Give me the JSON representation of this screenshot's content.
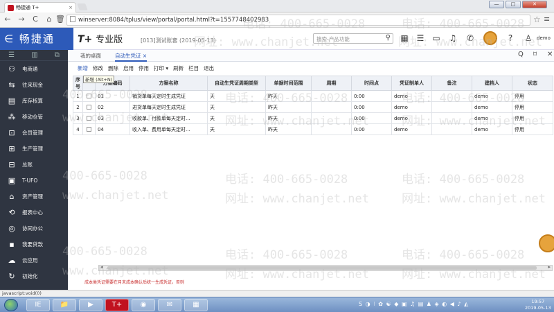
{
  "browser": {
    "tab_title": "畅捷通 T+",
    "tab_close": "×",
    "url": "winserver:8084/tplus/view/portal/portal.html?t=1557748402983",
    "back": "←",
    "forward": "→",
    "reload": "C",
    "home": "⌂",
    "star": "☆",
    "menu": "≡",
    "min": "—",
    "max": "□",
    "close": "✕"
  },
  "header": {
    "logo": "∈ 畅捷通",
    "product": "T+",
    "edition": "专业版",
    "account": "[013]测试账套 (2019-05-13)",
    "search_placeholder": "搜索-产品功能",
    "user": "demo",
    "icons": [
      "calculator-icon",
      "list-icon",
      "message-icon",
      "bell-icon",
      "phone-icon",
      "help-icon",
      "user-icon"
    ]
  },
  "sidebar": {
    "top": [
      "☰",
      "▥",
      "⧉"
    ],
    "items": [
      {
        "icon": "⚇",
        "label": "电商通"
      },
      {
        "icon": "⇆",
        "label": "往来现金"
      },
      {
        "icon": "▤",
        "label": "库存核算"
      },
      {
        "icon": "⁂",
        "label": "移动仓管"
      },
      {
        "icon": "⊡",
        "label": "会员管理"
      },
      {
        "icon": "⊞",
        "label": "生产管理"
      },
      {
        "icon": "⊟",
        "label": "总账"
      },
      {
        "icon": "▣",
        "label": "T-UFO"
      },
      {
        "icon": "⌂",
        "label": "资产管理"
      },
      {
        "icon": "⟲",
        "label": "报表中心"
      },
      {
        "icon": "◎",
        "label": "协同办公"
      },
      {
        "icon": "▪",
        "label": "我要贷款"
      },
      {
        "icon": "☁",
        "label": "云应用"
      },
      {
        "icon": "↻",
        "label": "初始化"
      }
    ]
  },
  "tabs": [
    {
      "label": "我的桌面"
    },
    {
      "label": "自动生凭证",
      "close": "×"
    }
  ],
  "tab_tools": [
    "Q",
    "⌑",
    "✕"
  ],
  "toolbar": {
    "items": [
      "新增",
      "修改",
      "删除",
      "启用",
      "停用",
      "打印 ▾",
      "刷新",
      "栏目",
      "退出"
    ],
    "tooltip": "新增 (Alt+N)"
  },
  "table": {
    "headers": [
      "序号",
      "",
      "方案编码",
      "方案名称",
      "自动生凭证周期类型",
      "单据时间范围",
      "周期",
      "时间点",
      "凭证制单人",
      "备注",
      "建档人",
      "状态"
    ],
    "rows": [
      {
        "no": "1",
        "code": "01",
        "name": "销货单每天定时生成凭证",
        "cycle": "天",
        "range": "昨天",
        "period": "",
        "time": "0:00",
        "maker": "demo",
        "remark": "",
        "creator": "demo",
        "status": "停用"
      },
      {
        "no": "2",
        "code": "02",
        "name": "进货单每天定时生成凭证",
        "cycle": "天",
        "range": "昨天",
        "period": "",
        "time": "0:00",
        "maker": "demo",
        "remark": "",
        "creator": "demo",
        "status": "停用"
      },
      {
        "no": "3",
        "code": "03",
        "name": "收款单、付款单每天定时...",
        "cycle": "天",
        "range": "昨天",
        "period": "",
        "time": "0:00",
        "maker": "demo",
        "remark": "",
        "creator": "demo",
        "status": "停用"
      },
      {
        "no": "4",
        "code": "04",
        "name": "收入单、费用单每天定时...",
        "cycle": "天",
        "range": "昨天",
        "period": "",
        "time": "0:00",
        "maker": "demo",
        "remark": "",
        "creator": "demo",
        "status": "停用"
      }
    ]
  },
  "scroll": {
    "left": "◂",
    "right": "▸"
  },
  "footer_note": "成本类凭证需要在月末成本确认后统一生成凭证，否则",
  "watermark": {
    "phone": "电话: 400-665-0028",
    "site": "网址: www.chanjet.net",
    "phone_part": "400-665-0028",
    "site_part": "www.chanjet.net",
    "phone_left": "电话: 400-665-0028",
    "site_left": "网址: www.chanjet.net"
  },
  "statusbar": "javascript:void(0)",
  "taskbar": {
    "apps": [
      "IE",
      "📁",
      "▶",
      "T+",
      "◉",
      "✉",
      "▦"
    ],
    "tray": "S ◑ ⁝ ✿ ☯ ◆ ▣ ♫ ▤ ♟ ◈ ◐ ◀ ♪ ◭",
    "time": "19:57",
    "date": "2019-05-13"
  }
}
